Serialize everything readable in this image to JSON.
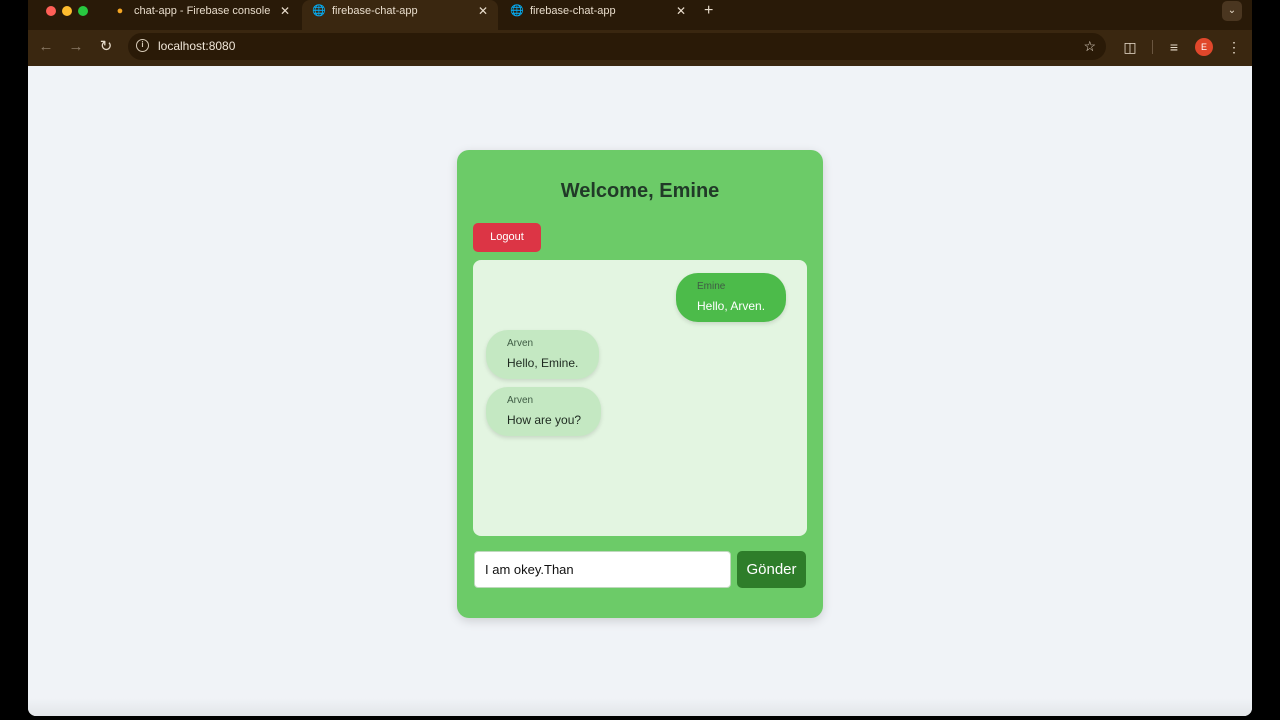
{
  "browser": {
    "tabs": [
      {
        "title": "chat-app - Firebase console",
        "icon": "firebase-icon",
        "active": false
      },
      {
        "title": "firebase-chat-app",
        "icon": "globe-icon",
        "active": true
      },
      {
        "title": "firebase-chat-app",
        "icon": "globe-icon",
        "active": false
      }
    ],
    "url": "localhost:8080",
    "profile_initial": "E",
    "colors": {
      "chrome": "#3a2710",
      "tab_strip": "#291a08",
      "profile": "#e0472b"
    }
  },
  "app": {
    "title": "Welcome, Emine",
    "logout_label": "Logout",
    "messages": [
      {
        "sender": "Emine",
        "text": "Hello, Arven.",
        "mine": true
      },
      {
        "sender": "Arven",
        "text": "Hello, Emine.",
        "mine": false
      },
      {
        "sender": "Arven",
        "text": "How are you?",
        "mine": false
      }
    ],
    "input_value": "I am okey.Than",
    "send_label": "Gönder",
    "colors": {
      "card": "#6ccb68",
      "logout": "#dc3545",
      "send": "#2e7d2a",
      "my_bubble": "#4cbb4a",
      "other_bubble": "#c4e8c2"
    }
  }
}
